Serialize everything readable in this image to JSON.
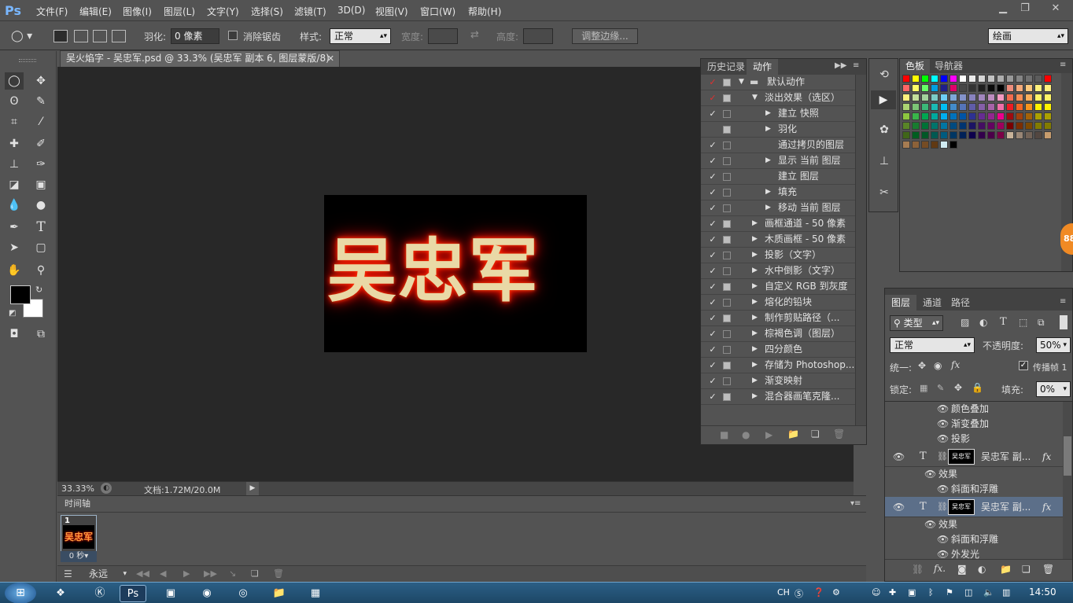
{
  "app": {
    "logo": "Ps"
  },
  "menu": [
    "文件(F)",
    "编辑(E)",
    "图像(I)",
    "图层(L)",
    "文字(Y)",
    "选择(S)",
    "滤镜(T)",
    "3D(D)",
    "视图(V)",
    "窗口(W)",
    "帮助(H)"
  ],
  "options": {
    "feather_label": "羽化:",
    "feather_value": "0 像素",
    "antialias_label": "消除锯齿",
    "style_label": "样式:",
    "style_value": "正常",
    "width_label": "宽度:",
    "height_label": "高度:",
    "refine_button": "调整边缘...",
    "workspace": "绘画"
  },
  "document": {
    "tab_title": "吴火焰字 - 吴忠军.psd @ 33.3% (吴忠军 副本 6, 图层蒙版/8)",
    "art_text": "吴忠军",
    "zoom": "33.33%",
    "doc_size": "文档:1.72M/20.0M"
  },
  "timeline": {
    "title": "时间轴",
    "frame_number": "1",
    "frame_thumb_text": "吴忠军",
    "frame_delay": "0 秒▾",
    "loop": "永远"
  },
  "history_panel": {
    "tabs": [
      "历史记录",
      "动作"
    ],
    "actions": [
      {
        "name": "默认动作",
        "level": 0,
        "check": "✓",
        "check_red": true,
        "box": "filled",
        "tri": "▼",
        "folder": true
      },
      {
        "name": "淡出效果（选区）",
        "level": 1,
        "check": "✓",
        "check_red": true,
        "box": "filled",
        "tri": "▼"
      },
      {
        "name": "建立 快照",
        "level": 2,
        "check": "✓",
        "box": "empty",
        "tri": "▶"
      },
      {
        "name": "羽化",
        "level": 2,
        "check": "",
        "box": "filled",
        "tri": "▶"
      },
      {
        "name": "通过拷贝的图层",
        "level": 2,
        "check": "✓",
        "box": "empty",
        "tri": ""
      },
      {
        "name": "显示 当前 图层",
        "level": 2,
        "check": "✓",
        "box": "empty",
        "tri": "▶"
      },
      {
        "name": "建立 图层",
        "level": 2,
        "check": "✓",
        "box": "empty",
        "tri": ""
      },
      {
        "name": "填充",
        "level": 2,
        "check": "✓",
        "box": "empty",
        "tri": "▶"
      },
      {
        "name": "移动 当前 图层",
        "level": 2,
        "check": "✓",
        "box": "empty",
        "tri": "▶"
      },
      {
        "name": "画框通道 - 50 像素",
        "level": 1,
        "check": "✓",
        "box": "filled",
        "tri": "▶"
      },
      {
        "name": "木质画框 - 50 像素",
        "level": 1,
        "check": "✓",
        "box": "filled",
        "tri": "▶"
      },
      {
        "name": "投影（文字）",
        "level": 1,
        "check": "✓",
        "box": "empty",
        "tri": "▶"
      },
      {
        "name": "水中倒影（文字）",
        "level": 1,
        "check": "✓",
        "box": "empty",
        "tri": "▶"
      },
      {
        "name": "自定义 RGB 到灰度",
        "level": 1,
        "check": "✓",
        "box": "filled",
        "tri": "▶"
      },
      {
        "name": "熔化的铅块",
        "level": 1,
        "check": "✓",
        "box": "empty",
        "tri": "▶"
      },
      {
        "name": "制作剪贴路径（...",
        "level": 1,
        "check": "✓",
        "box": "filled",
        "tri": "▶"
      },
      {
        "name": "棕褐色调（图层）",
        "level": 1,
        "check": "✓",
        "box": "empty",
        "tri": "▶"
      },
      {
        "name": "四分颜色",
        "level": 1,
        "check": "✓",
        "box": "empty",
        "tri": "▶"
      },
      {
        "name": "存储为 Photoshop...",
        "level": 1,
        "check": "✓",
        "box": "filled",
        "tri": "▶"
      },
      {
        "name": "渐变映射",
        "level": 1,
        "check": "✓",
        "box": "empty",
        "tri": "▶"
      },
      {
        "name": "混合器画笔克隆...",
        "level": 1,
        "check": "✓",
        "box": "filled",
        "tri": "▶"
      }
    ]
  },
  "swatches": {
    "tabs": [
      "色板",
      "导航器"
    ],
    "rows": [
      [
        "#ff0000",
        "#ffff00",
        "#00ff00",
        "#00ffff",
        "#0000ff",
        "#ff00ff",
        "#ffffff",
        "#ebebeb",
        "#d6d6d6",
        "#c2c2c2",
        "#adadad",
        "#999999",
        "#858585",
        "#707070",
        "#5c5c5c",
        "#ff0000"
      ],
      [
        "#ff6666",
        "#ffff66",
        "#66ff66",
        "#00a0e0",
        "#1e1e8c",
        "#e0006a",
        "#474747",
        "#333333",
        "#1f1f1f",
        "#0a0a0a",
        "#000000",
        "#ee8d7c",
        "#f4aa7a",
        "#fbc97d",
        "#fff27d",
        "#fff27d"
      ],
      [
        "#fff27d",
        "#c4df9b",
        "#a3d39c",
        "#7accc8",
        "#6dcff6",
        "#7ea7d8",
        "#8493ca",
        "#8882be",
        "#a186be",
        "#bd8cbf",
        "#f49ac2",
        "#f26c4f",
        "#f68e55",
        "#fbaf5c",
        "#fff467",
        "#fff467"
      ],
      [
        "#acd372",
        "#7cc576",
        "#3bb878",
        "#1abbb4",
        "#00bff3",
        "#438ccb",
        "#5574b9",
        "#605ca8",
        "#855fa8",
        "#a763a8",
        "#f06ea9",
        "#ed1c24",
        "#f26522",
        "#f7941d",
        "#fff200",
        "#fff200"
      ],
      [
        "#8dc63f",
        "#39b54a",
        "#00a651",
        "#00a99d",
        "#00aeef",
        "#0072bc",
        "#0054a6",
        "#2e3192",
        "#662d91",
        "#92278f",
        "#ec008c",
        "#9e0b0f",
        "#a0410d",
        "#a36209",
        "#aba000",
        "#aba000"
      ],
      [
        "#598527",
        "#197b30",
        "#007236",
        "#00746b",
        "#0076a3",
        "#004a80",
        "#003471",
        "#1b1464",
        "#440e62",
        "#630460",
        "#9e005d",
        "#790000",
        "#7b2e00",
        "#7d4900",
        "#827b00",
        "#827b00"
      ],
      [
        "#406618",
        "#005e20",
        "#005826",
        "#005952",
        "#005b7f",
        "#003663",
        "#002157",
        "#0d004c",
        "#32004b",
        "#4b0049",
        "#7b0046",
        "#c7b299",
        "#998675",
        "#736357",
        "#534741",
        "#c69c6d"
      ],
      [
        "#a67c52",
        "#8c6239",
        "#754c24",
        "#603913",
        "#d0ebf2",
        "#000000"
      ]
    ]
  },
  "layers_panel": {
    "tabs": [
      "图层",
      "通道",
      "路径"
    ],
    "filter": "类型",
    "blend_mode": "正常",
    "opacity_label": "不透明度:",
    "opacity_value": "50%",
    "unify_label": "统一:",
    "propagate_label": "传播帧 1",
    "lock_label": "锁定:",
    "fill_label": "填充:",
    "fill_value": "0%",
    "rows": [
      {
        "kind": "effect",
        "name": "颜色叠加"
      },
      {
        "kind": "effect",
        "name": "渐变叠加"
      },
      {
        "kind": "effect",
        "name": "投影"
      },
      {
        "kind": "layer",
        "name": "吴忠军 副...",
        "thumb": "吴忠军",
        "selected": false
      },
      {
        "kind": "effects-header",
        "name": "效果"
      },
      {
        "kind": "effect",
        "name": "斜面和浮雕"
      },
      {
        "kind": "layer",
        "name": "吴忠军 副...",
        "thumb": "吴忠军",
        "selected": true
      },
      {
        "kind": "effects-header",
        "name": "效果"
      },
      {
        "kind": "effect",
        "name": "斜面和浮雕"
      },
      {
        "kind": "effect",
        "name": "外发光"
      }
    ]
  },
  "side_badge": "88",
  "taskbar": {
    "lang": "CH",
    "time": "14:50"
  }
}
